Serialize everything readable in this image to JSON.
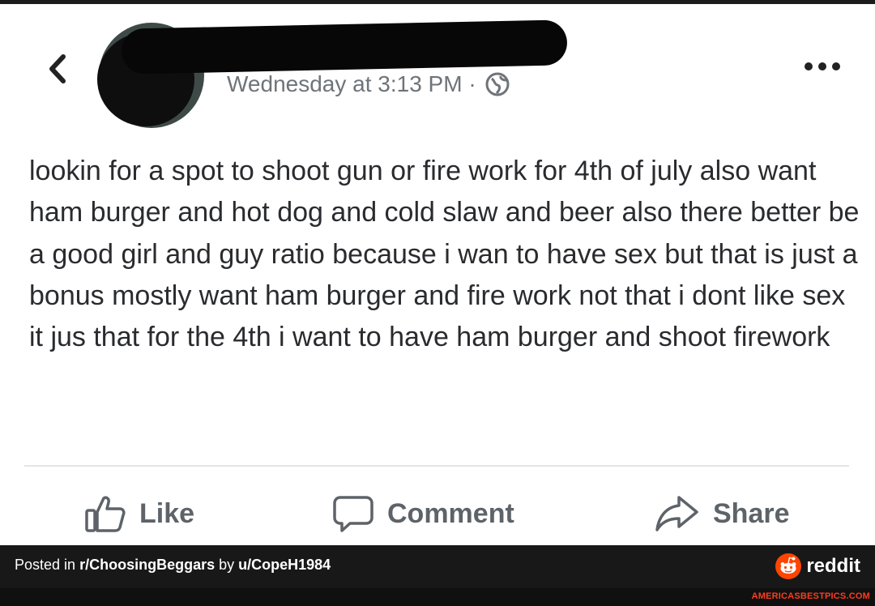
{
  "post": {
    "timestamp": "Wednesday at 3:13 PM ·",
    "privacy_icon": "globe-icon",
    "body": "lookin for a spot to shoot gun or fire work for 4th of july also want ham burger and hot dog and cold slaw and beer also there better be a good girl and guy ratio because i wan to have sex but that is just a bonus mostly want ham burger and fire work not that i dont like sex it jus that for the 4th i want to have ham burger and shoot firework"
  },
  "actions": {
    "like_label": "Like",
    "comment_label": "Comment",
    "share_label": "Share"
  },
  "footer": {
    "posted_in": "Posted in",
    "subreddit": "r/ChoosingBeggars",
    "by": "by",
    "user": "u/CopeH1984",
    "brand": "reddit",
    "watermark": "AMERICASBESTPICS.COM"
  },
  "colors": {
    "text": "#2a2b2e",
    "muted": "#6e7479",
    "footer_bg": "#181818",
    "reddit_orange": "#ff4500"
  }
}
